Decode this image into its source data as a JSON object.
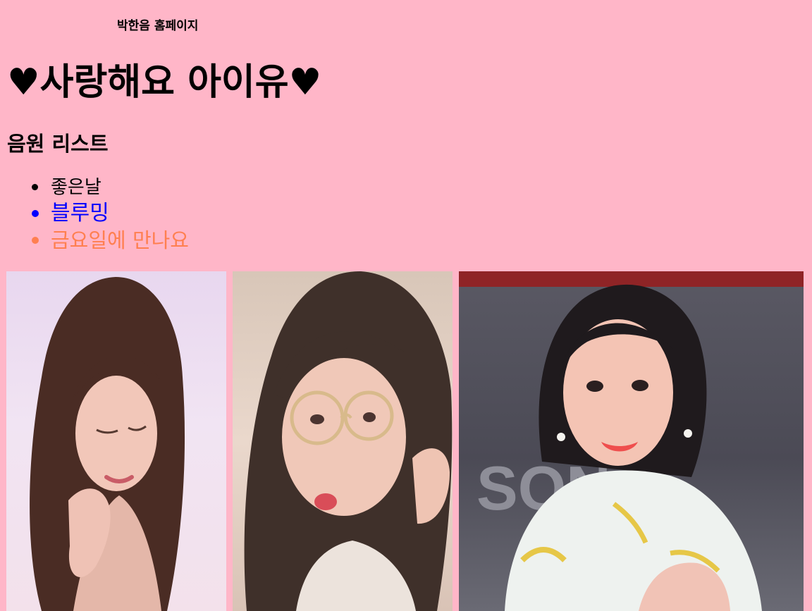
{
  "site_title": "박한음 홈페이지",
  "main_heading": "♥사랑해요 아이유♥",
  "sub_heading": "음원 리스트",
  "songs": [
    {
      "title": "좋은날",
      "color": "#000000"
    },
    {
      "title": "블루밍",
      "color": "#0000ff"
    },
    {
      "title": "금요일에 만나요",
      "color": "#ff7f50"
    }
  ],
  "colors": {
    "background": "#ffb6c8"
  },
  "photos": [
    {
      "name": "iu-photo-1"
    },
    {
      "name": "iu-photo-2"
    },
    {
      "name": "iu-photo-3"
    }
  ]
}
